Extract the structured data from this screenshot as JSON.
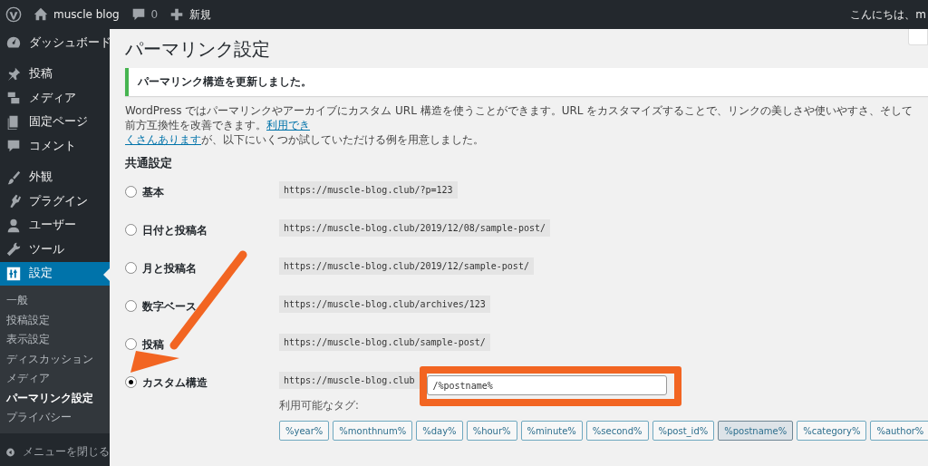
{
  "admin_bar": {
    "site_name": "muscle blog",
    "comments_count": "0",
    "new_label": "新規",
    "greeting": "こんにちは、m"
  },
  "sidebar": {
    "groups": [
      [
        {
          "label": "ダッシュボード",
          "selected": false
        }
      ],
      [
        {
          "label": "投稿",
          "selected": false
        },
        {
          "label": "メディア",
          "selected": false
        },
        {
          "label": "固定ページ",
          "selected": false
        },
        {
          "label": "コメント",
          "selected": false
        }
      ],
      [
        {
          "label": "外観",
          "selected": false
        },
        {
          "label": "プラグイン",
          "selected": false
        },
        {
          "label": "ユーザー",
          "selected": false
        },
        {
          "label": "ツール",
          "selected": false
        },
        {
          "label": "設定",
          "selected": true
        }
      ]
    ],
    "submenu": [
      {
        "label": "一般",
        "selected": false
      },
      {
        "label": "投稿設定",
        "selected": false
      },
      {
        "label": "表示設定",
        "selected": false
      },
      {
        "label": "ディスカッション",
        "selected": false
      },
      {
        "label": "メディア",
        "selected": false
      },
      {
        "label": "パーマリンク設定",
        "selected": true
      },
      {
        "label": "プライバシー",
        "selected": false
      }
    ],
    "collapse_label": "メニューを閉じる"
  },
  "page": {
    "title": "パーマリンク設定",
    "notice": "パーマリンク構造を更新しました。",
    "description": {
      "text_before": "WordPress ではパーマリンクやアーカイブにカスタム URL 構造を使うことができます。URL をカスタマイズすることで、リンクの美しさや使いやすさ、そして前方互換性を改善できます。",
      "link_line1": "利用でき",
      "link_line2": "くさんあります",
      "text_after": "が、以下にいくつか試していただける例を用意しました。"
    },
    "section_heading": "共通設定",
    "options": [
      {
        "kind": "preset",
        "label": "基本",
        "example": "https://muscle-blog.club/?p=123",
        "selected": false
      },
      {
        "kind": "preset",
        "label": "日付と投稿名",
        "example": "https://muscle-blog.club/2019/12/08/sample-post/",
        "selected": false
      },
      {
        "kind": "preset",
        "label": "月と投稿名",
        "example": "https://muscle-blog.club/2019/12/sample-post/",
        "selected": false
      },
      {
        "kind": "preset",
        "label": "数字ベース",
        "example": "https://muscle-blog.club/archives/123",
        "selected": false
      },
      {
        "kind": "preset",
        "label": "投稿",
        "example": "https://muscle-blog.club/sample-post/",
        "selected": false
      },
      {
        "kind": "custom",
        "label": "カスタム構造",
        "example": "https://muscle-blog.club",
        "value": "/%postname%",
        "selected": true
      }
    ],
    "tags_label": "利用可能なタグ:",
    "tags": [
      {
        "label": "%year%",
        "selected": false
      },
      {
        "label": "%monthnum%",
        "selected": false
      },
      {
        "label": "%day%",
        "selected": false
      },
      {
        "label": "%hour%",
        "selected": false
      },
      {
        "label": "%minute%",
        "selected": false
      },
      {
        "label": "%second%",
        "selected": false
      },
      {
        "label": "%post_id%",
        "selected": false
      },
      {
        "label": "%postname%",
        "selected": true
      },
      {
        "label": "%category%",
        "selected": false
      },
      {
        "label": "%author%",
        "selected": false
      }
    ]
  }
}
